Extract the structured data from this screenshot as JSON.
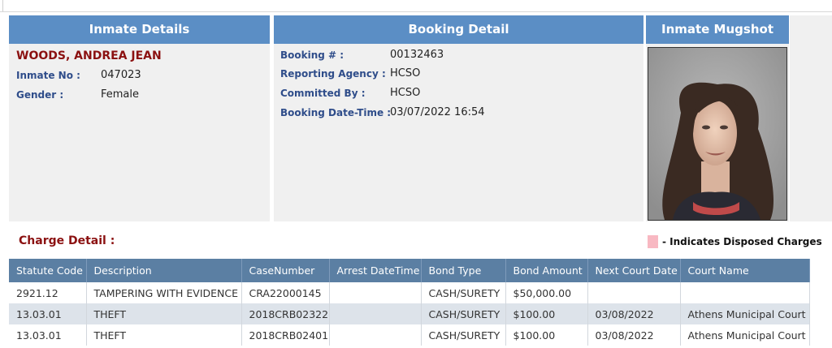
{
  "inmate": {
    "header": "Inmate Details",
    "name": "WOODS, ANDREA JEAN",
    "inmate_no_label": "Inmate No :",
    "inmate_no": "047023",
    "gender_label": "Gender :",
    "gender": "Female"
  },
  "booking": {
    "header": "Booking Detail",
    "booking_no_label": "Booking # :",
    "booking_no": "00132463",
    "agency_label": "Reporting Agency :",
    "agency": "HCSO",
    "committed_label": "Committed By :",
    "committed": "HCSO",
    "datetime_label": "Booking Date-Time :",
    "datetime": "03/07/2022 16:54"
  },
  "mugshot": {
    "header": "Inmate Mugshot"
  },
  "charges": {
    "title": "Charge Detail :",
    "legend": "- Indicates Disposed Charges",
    "legend_color": "#f8b8c2",
    "columns": [
      "Statute Code",
      "Description",
      "CaseNumber",
      "Arrest DateTime",
      "Bond Type",
      "Bond Amount",
      "Next Court Date",
      "Court Name"
    ],
    "rows": [
      [
        "2921.12",
        "TAMPERING WITH EVIDENCE",
        "CRA22000145",
        "",
        "CASH/SURETY",
        "$50,000.00",
        "",
        ""
      ],
      [
        "13.03.01",
        "THEFT",
        "2018CRB02322",
        "",
        "CASH/SURETY",
        "$100.00",
        "03/08/2022",
        "Athens Municipal Court"
      ],
      [
        "13.03.01",
        "THEFT",
        "2018CRB02401",
        "",
        "CASH/SURETY",
        "$100.00",
        "03/08/2022",
        "Athens Municipal Court"
      ]
    ]
  },
  "colors": {
    "header_blue": "#5b8ec5",
    "table_header": "#5b7fa3",
    "name_red": "#8b1111",
    "label_blue": "#2f4d8a"
  }
}
